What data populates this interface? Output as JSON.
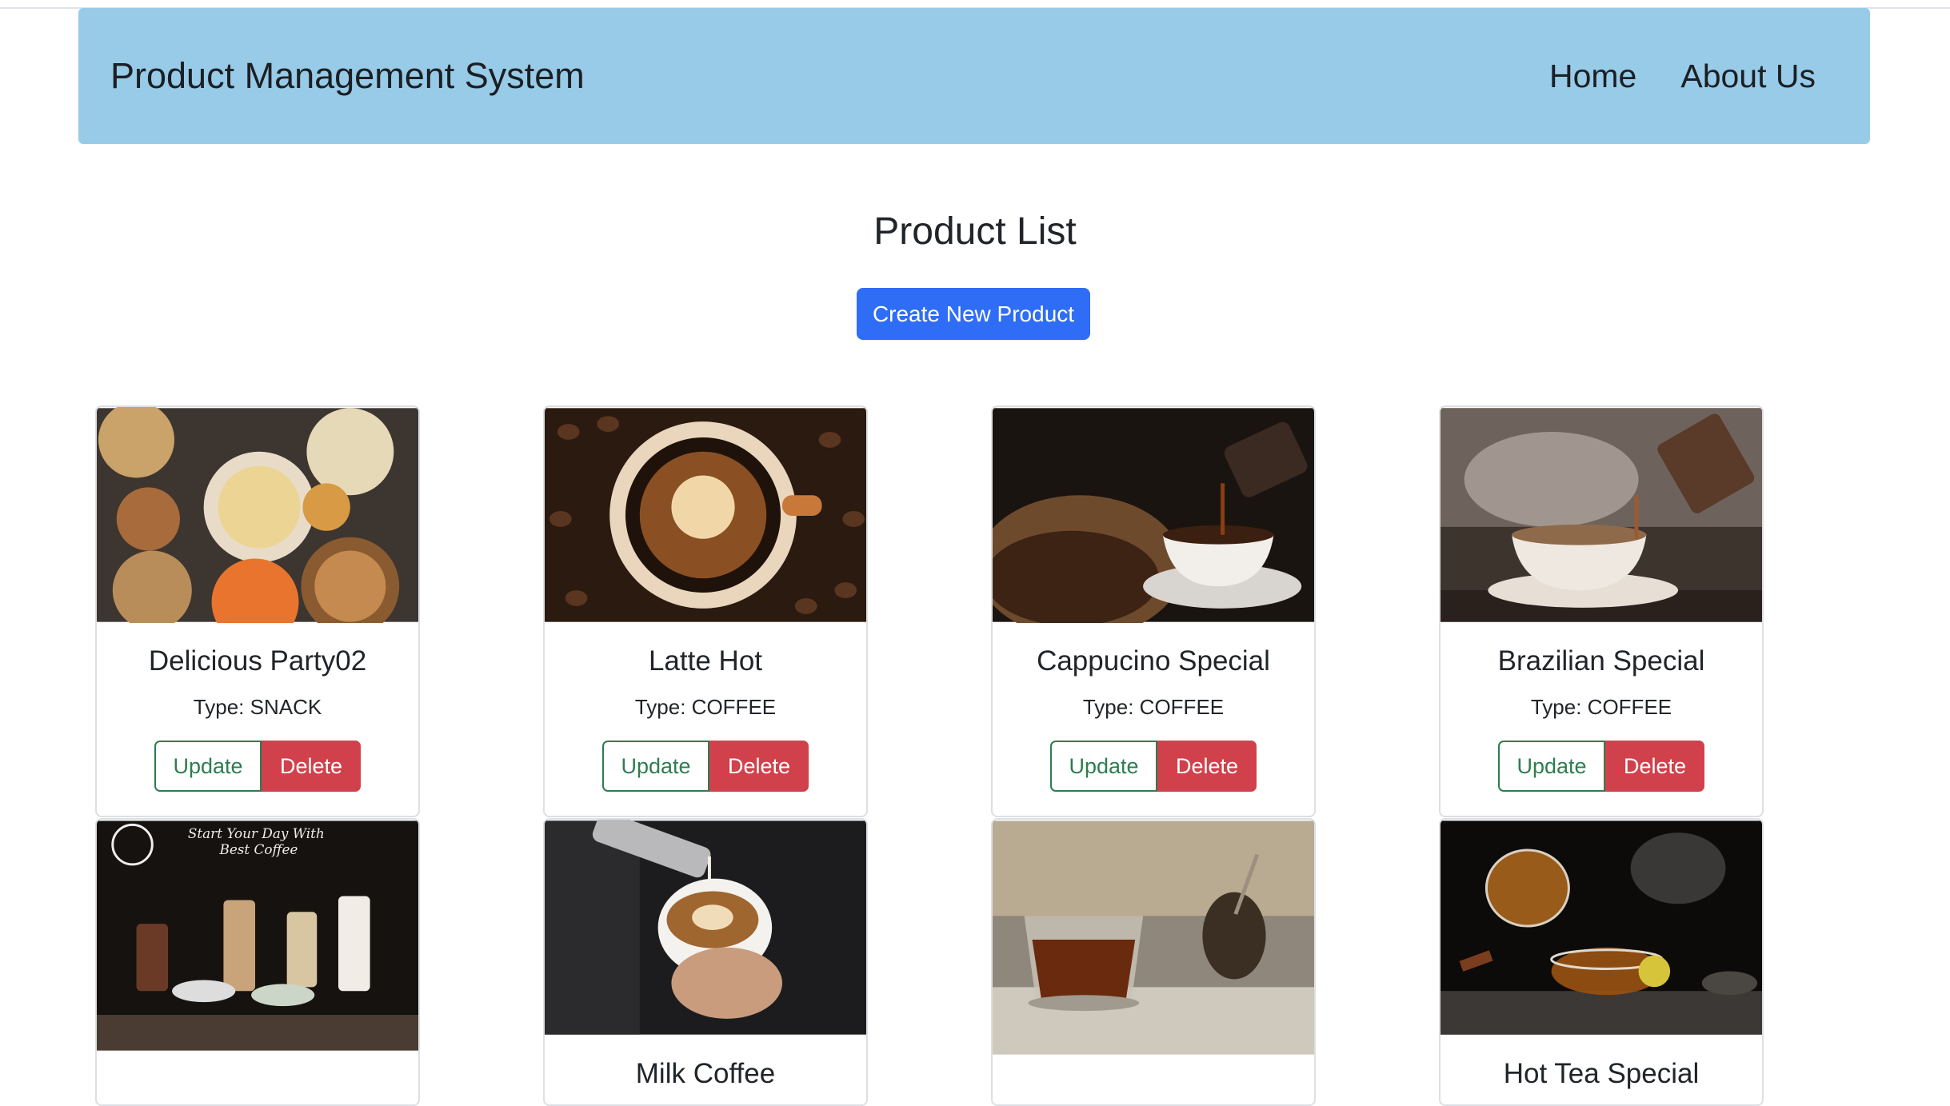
{
  "nav": {
    "brand": "Product Management System",
    "links": [
      "Home",
      "About Us"
    ]
  },
  "main": {
    "title": "Product List",
    "create_button": "Create New Product"
  },
  "products": [
    {
      "name": "Delicious Party02",
      "type": "Type: SNACK",
      "image": "snack-platter-photo"
    },
    {
      "name": "Latte Hot",
      "type": "Type: COFFEE",
      "image": "latte-art-beans-photo"
    },
    {
      "name": "Cappucino Special",
      "type": "Type: COFFEE",
      "image": "coffee-pour-beans-photo"
    },
    {
      "name": "Brazilian Special",
      "type": "Type: COFFEE",
      "image": "moka-pot-pour-photo"
    },
    {
      "name": "",
      "type": "",
      "image": "coffee-house-menu-photo"
    },
    {
      "name": "Milk Coffee",
      "type": "",
      "image": "milk-pour-latte-photo"
    },
    {
      "name": "",
      "type": "",
      "image": "tea-glass-photo"
    },
    {
      "name": "Hot Tea Special",
      "type": "",
      "image": "teapot-pour-photo"
    }
  ],
  "card_actions": {
    "update": "Update",
    "delete": "Delete"
  },
  "colors": {
    "navbar": "#97cbe8",
    "primary": "#2f6df6",
    "success": "#2e7d4f",
    "danger": "#d0414c"
  }
}
